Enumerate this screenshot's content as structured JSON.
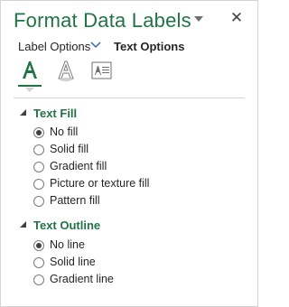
{
  "pane": {
    "title": "Format Data Labels",
    "pin_icon": "chevron-down-icon",
    "close_icon": "close-icon",
    "close_glyph": "✕"
  },
  "tabs": {
    "label_options": "Label Options",
    "text_options": "Text Options",
    "selected": "Text Options"
  },
  "icons": [
    {
      "name": "text-fill-outline-icon",
      "selected": true
    },
    {
      "name": "text-effects-icon",
      "selected": false
    },
    {
      "name": "textbox-icon",
      "selected": false
    }
  ],
  "text_fill": {
    "heading": "Text Fill",
    "options": [
      {
        "label": "No fill",
        "checked": true
      },
      {
        "label": "Solid fill",
        "checked": false
      },
      {
        "label": "Gradient fill",
        "checked": false
      },
      {
        "label": "Picture or texture fill",
        "checked": false
      },
      {
        "label": "Pattern fill",
        "checked": false
      }
    ]
  },
  "text_outline": {
    "heading": "Text Outline",
    "options": [
      {
        "label": "No line",
        "checked": true
      },
      {
        "label": "Solid line",
        "checked": false
      },
      {
        "label": "Gradient line",
        "checked": false
      }
    ]
  },
  "colors": {
    "accent": "#217346",
    "text": "#262626",
    "border": "#d4d4d4"
  }
}
